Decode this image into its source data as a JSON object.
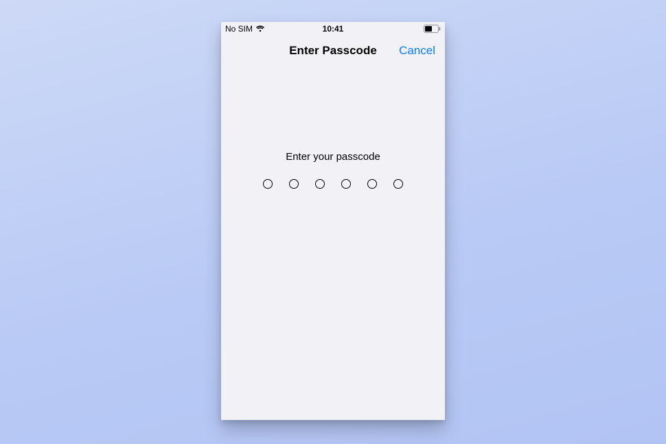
{
  "status_bar": {
    "carrier": "No SIM",
    "time": "10:41"
  },
  "nav": {
    "title": "Enter Passcode",
    "cancel_label": "Cancel"
  },
  "content": {
    "prompt": "Enter your passcode",
    "passcode_length": 6,
    "filled_count": 0
  },
  "colors": {
    "accent": "#0a7cff",
    "screen_bg": "#f2f1f6"
  }
}
